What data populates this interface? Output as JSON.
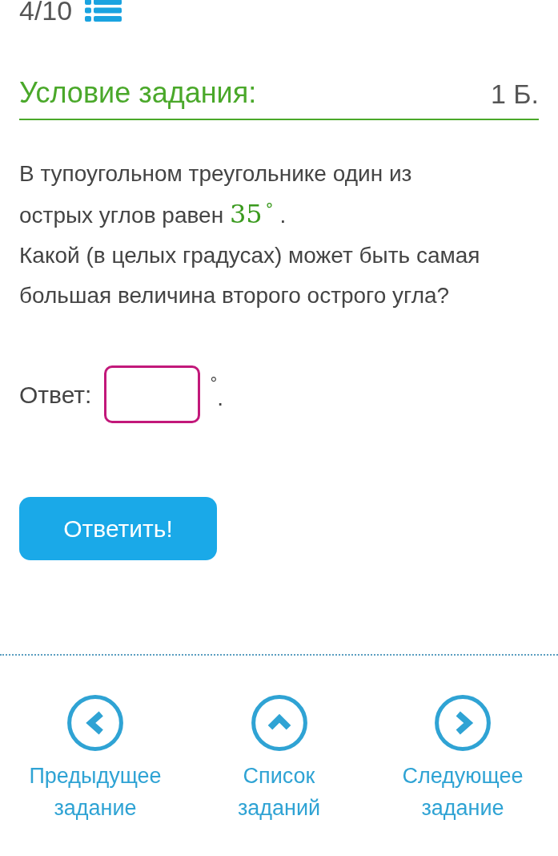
{
  "progress": {
    "counter": "4/10"
  },
  "task": {
    "heading": "Условие задания:",
    "points": "1 Б.",
    "statement": {
      "text_before": [
        "В тупоугольном треугольнике один из",
        "острых углов равен"
      ],
      "math_value": "35",
      "math_unit": "°",
      "text_after": ".",
      "question": "Какой (в целых градусах) может быть самая большая величина второго острого угла?"
    }
  },
  "answer": {
    "label": "Ответ:",
    "unit": "°",
    "suffix": "."
  },
  "submit_button": "Ответить!",
  "navigation": [
    {
      "kind": "previous",
      "label": "Предыдущее задание"
    },
    {
      "kind": "list",
      "label": "Список заданий"
    },
    {
      "kind": "next",
      "label": "Следующее задание"
    }
  ]
}
